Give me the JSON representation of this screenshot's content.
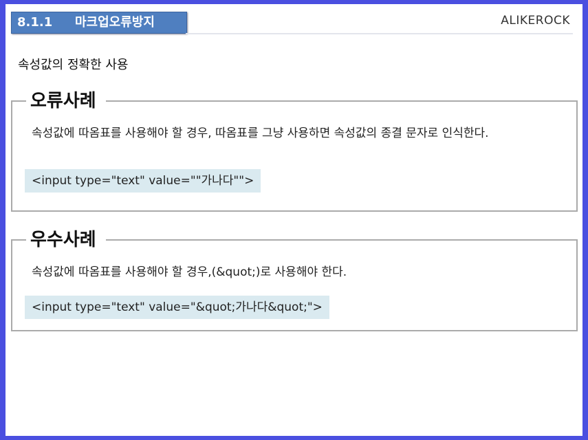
{
  "header": {
    "section_number": "8.1.1",
    "section_title": "마크업오류방지",
    "brand": "ALIKEROCK"
  },
  "subtitle": "속성값의 정확한 사용",
  "bad_example": {
    "heading": "오류사례",
    "description": "속성값에 따옴표를 사용해야 할 경우, 따옴표를 그냥 사용하면 속성값의 종결 문자로 인식한다.",
    "code": "<input type=\"text\" value=\"\"가나다\"\">"
  },
  "good_example": {
    "heading": "우수사례",
    "description": "속성값에 따옴표를 사용해야 할 경우,(&quot;)로 사용해야 한다.",
    "code": "<input type=\"text\" value=\"&quot;가나다&quot;\">"
  }
}
